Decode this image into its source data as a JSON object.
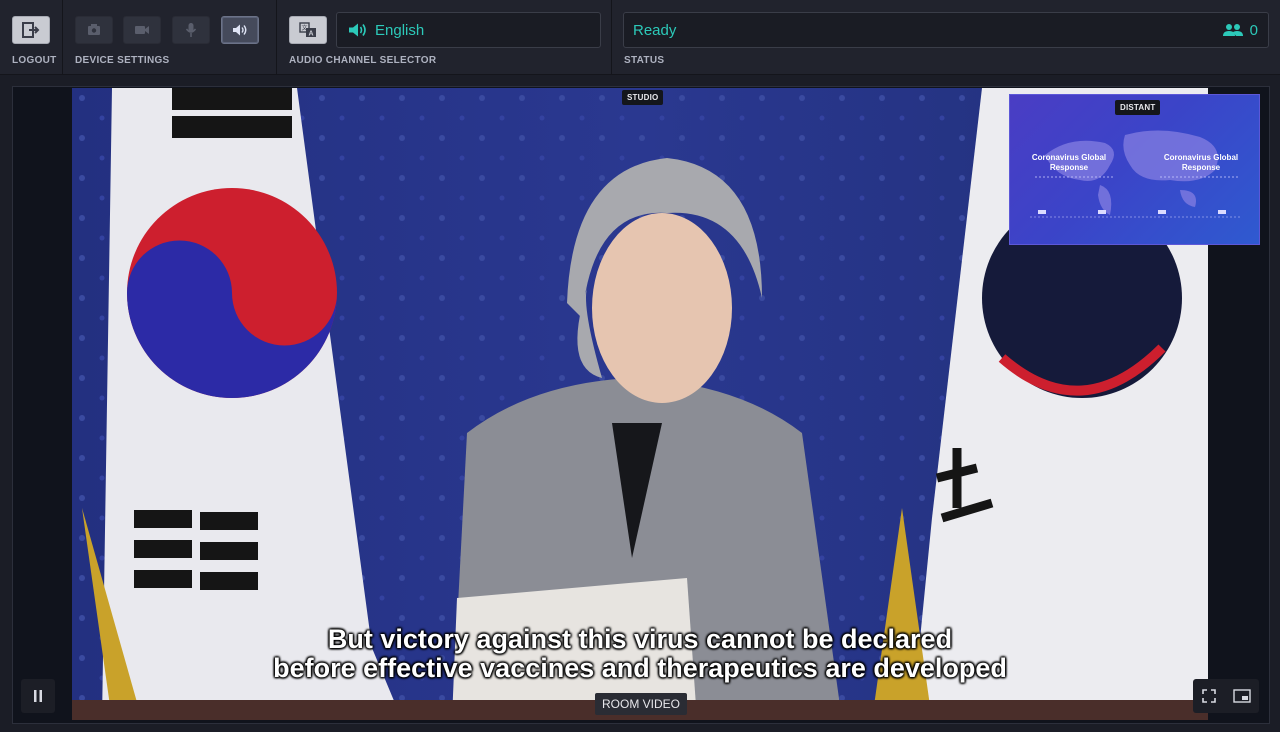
{
  "toolbar": {
    "logout_label": "LOGOUT",
    "device_settings_label": "DEVICE SETTINGS",
    "audio_channel_label": "AUDIO CHANNEL SELECTOR",
    "status_label": "STATUS",
    "audio_channel_value": "English",
    "status_value": "Ready",
    "participant_count": "0"
  },
  "video": {
    "studio_tag": "STUDIO",
    "distant_tag": "DISTANT",
    "pip_left_title": "Coronavirus Global Response",
    "pip_right_title": "Coronavirus Global Response",
    "subtitle_line1": "But victory against this virus cannot be declared",
    "subtitle_line2": "before effective vaccines and therapeutics are developed",
    "room_label": "ROOM VIDEO"
  },
  "icons": [
    "logout-icon",
    "camera-off-icon",
    "video-icon",
    "microphone-icon",
    "speaker-icon",
    "translate-icon",
    "speaker-icon",
    "users-icon",
    "pause-icon",
    "fullscreen-icon",
    "picture-in-picture-icon"
  ],
  "colors": {
    "accent": "#2cc9b9",
    "toolbar_bg": "#21232d"
  }
}
